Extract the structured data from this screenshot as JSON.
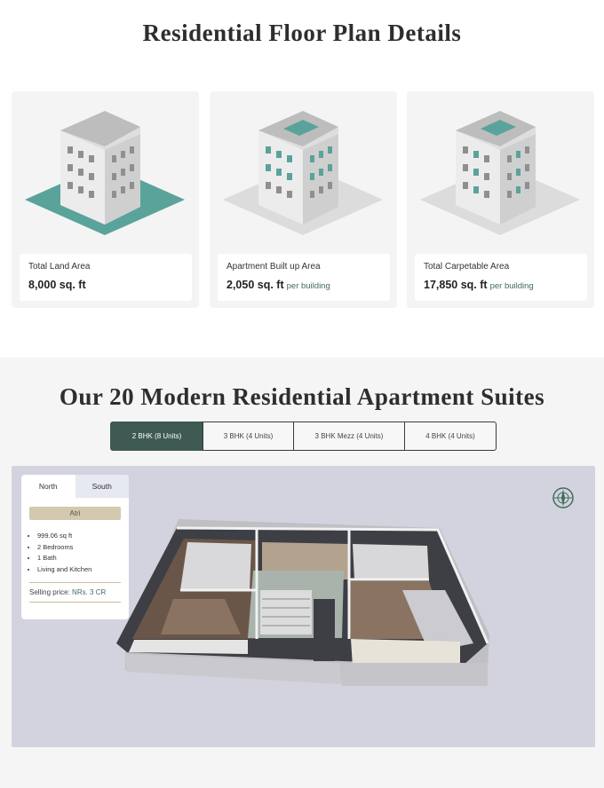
{
  "floor_plan": {
    "title": "Residential Floor Plan Details",
    "cards": [
      {
        "label": "Total Land Area",
        "value": "8,000 sq. ft",
        "suffix": ""
      },
      {
        "label": "Apartment Built up Area",
        "value": "2,050 sq. ft",
        "suffix": "per building"
      },
      {
        "label": "Total Carpetable Area",
        "value": "17,850 sq. ft",
        "suffix": "per building"
      }
    ]
  },
  "suites": {
    "title": "Our 20 Modern Residential Apartment Suites",
    "tabs": [
      "2 BHK (8 Units)",
      "3 BHK (4 Units)",
      "3 BHK Mezz (4 Units)",
      "4 BHK (4 Units)"
    ],
    "active_tab": 0,
    "panel": {
      "tabs": [
        "North",
        "South"
      ],
      "unit_name": "Atri",
      "features": [
        "999.06 sq ft",
        "2 Bedrooms",
        "1 Bath",
        "Living and Kitchen"
      ],
      "price_label": "Selling price:",
      "price_value": "NRs. 3 CR"
    }
  },
  "colors": {
    "accent": "#3e5a52",
    "teal": "#5aa39a",
    "gold": "#d3c9ae",
    "viewer_bg": "#d3d3df"
  }
}
